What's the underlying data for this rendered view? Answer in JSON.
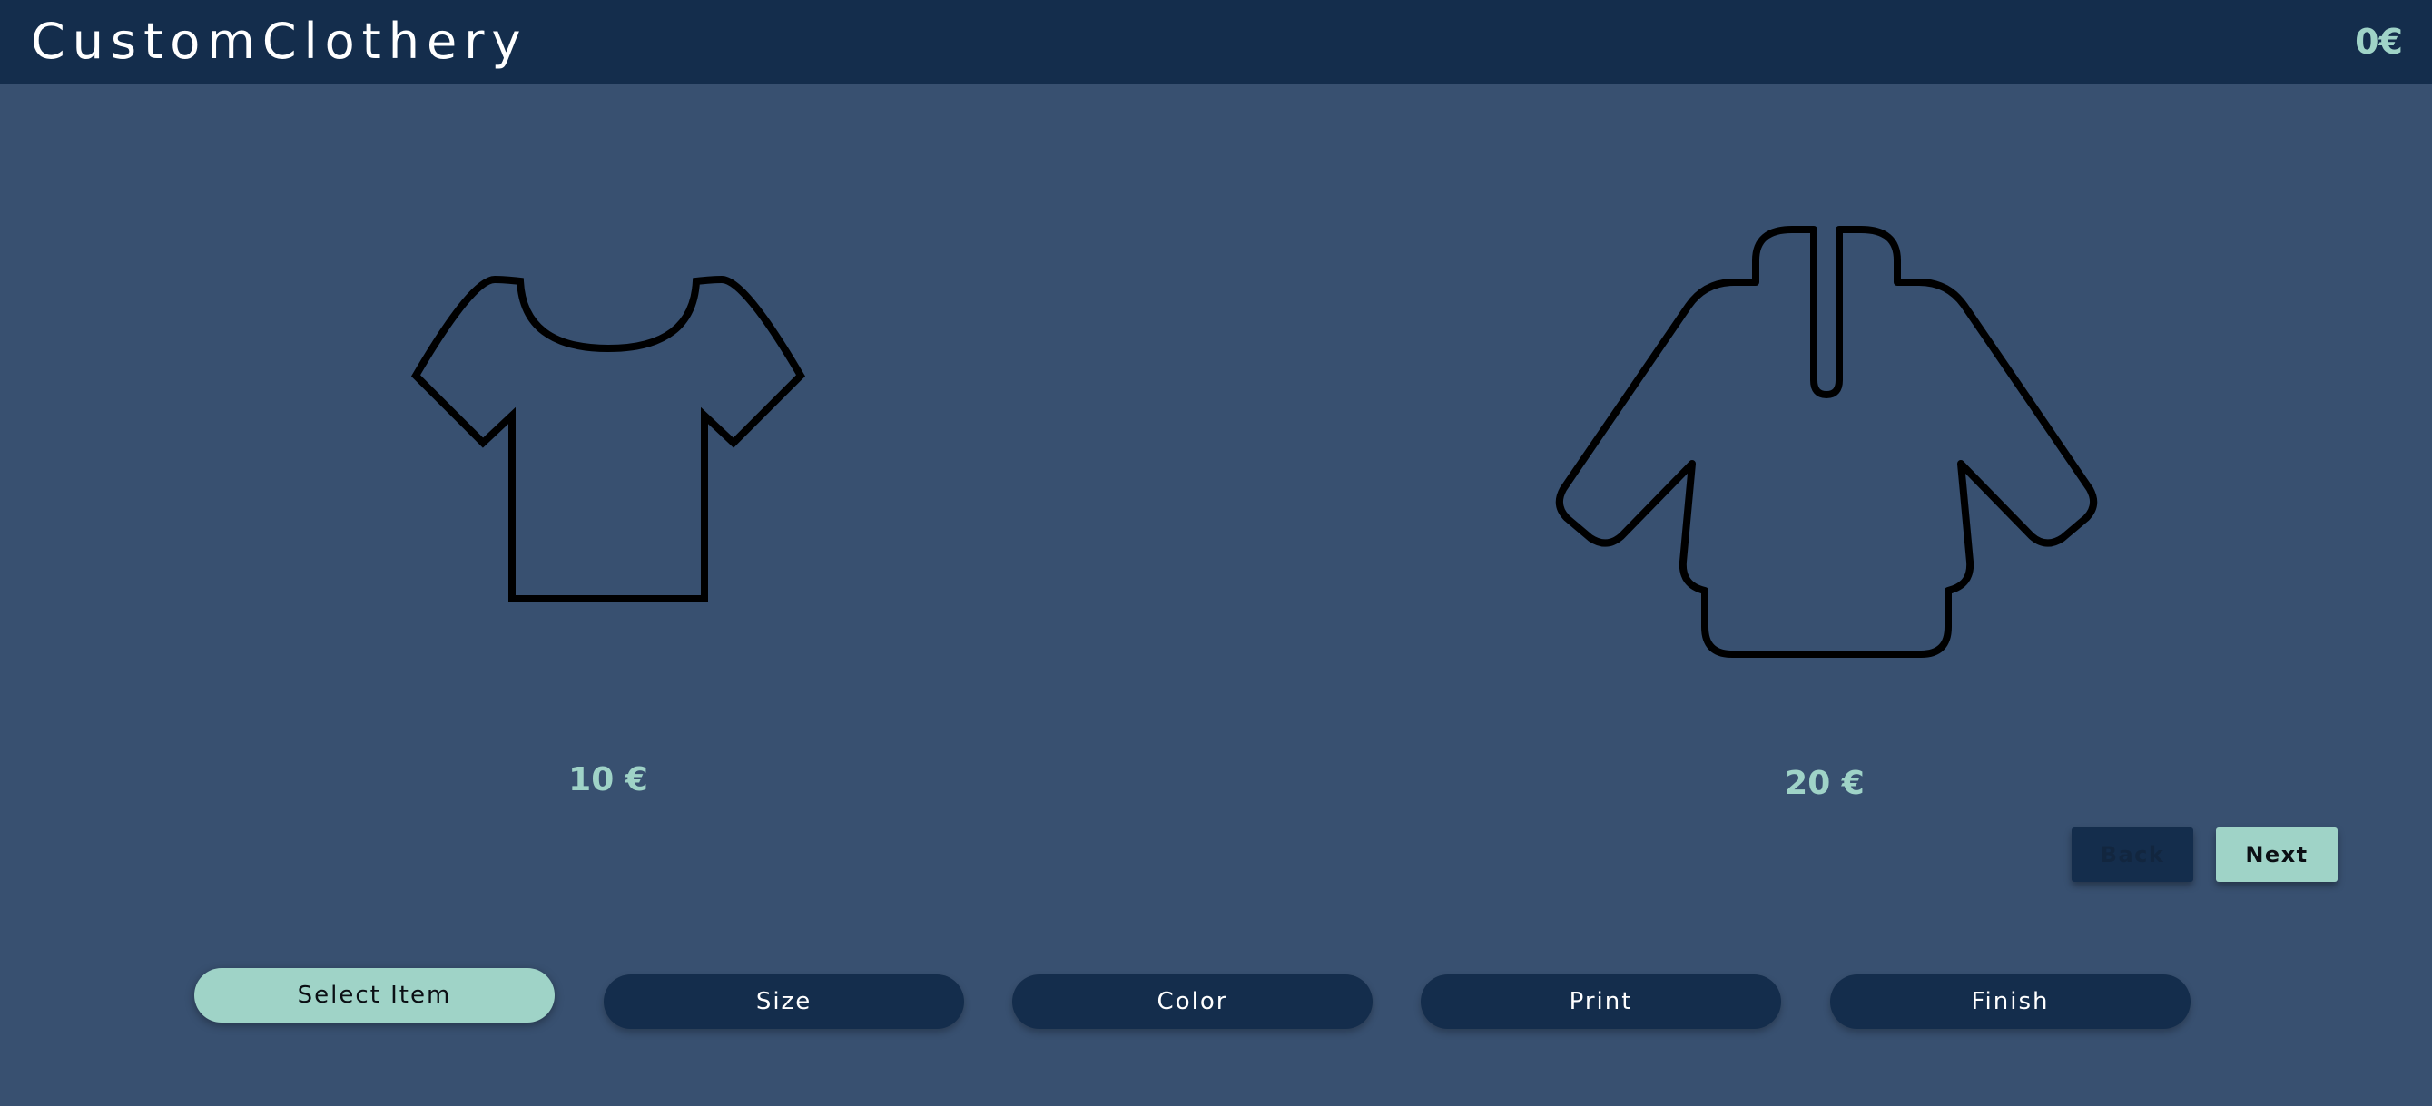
{
  "header": {
    "brand": "CustomClothery",
    "cart_total": "0€"
  },
  "items": [
    {
      "name": "t-shirt",
      "icon": "tshirt-icon",
      "price": "10 €"
    },
    {
      "name": "hoodie",
      "icon": "hoodie-icon",
      "price": "20 €"
    }
  ],
  "navigation": {
    "back_label": "Back",
    "next_label": "Next"
  },
  "steps": [
    {
      "label": "Select Item",
      "active": true
    },
    {
      "label": "Size",
      "active": false
    },
    {
      "label": "Color",
      "active": false
    },
    {
      "label": "Print",
      "active": false
    },
    {
      "label": "Finish",
      "active": false
    }
  ],
  "colors": {
    "header_bg": "#142d4c",
    "page_bg": "#385070",
    "accent": "#9fd3c7",
    "text_light": "#ffffff"
  }
}
